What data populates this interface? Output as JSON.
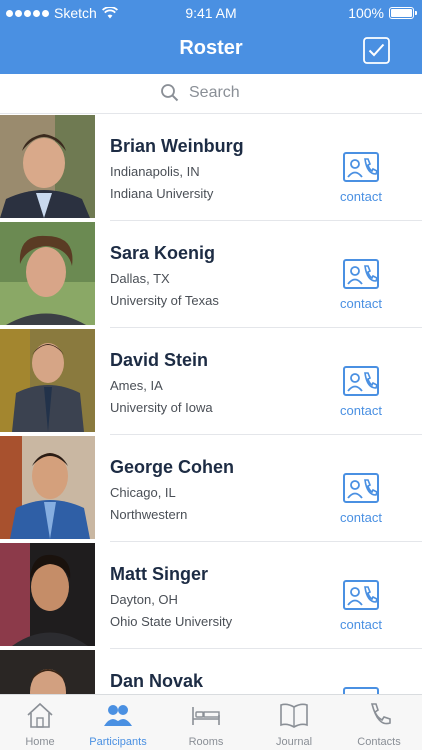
{
  "status_bar": {
    "carrier": "Sketch",
    "time": "9:41 AM",
    "battery": "100%"
  },
  "nav": {
    "title": "Roster",
    "action_icon": "checkbox-icon"
  },
  "search": {
    "placeholder": "Search",
    "icon": "search-icon"
  },
  "participants": [
    {
      "name": "Brian Weinburg",
      "location": "Indianapolis, IN",
      "school": "Indiana University",
      "contact_label": "contact"
    },
    {
      "name": "Sara Koenig",
      "location": "Dallas, TX",
      "school": "University of Texas",
      "contact_label": "contact"
    },
    {
      "name": "David Stein",
      "location": "Ames, IA",
      "school": "University of Iowa",
      "contact_label": "contact"
    },
    {
      "name": "George Cohen",
      "location": "Chicago, IL",
      "school": "Northwestern",
      "contact_label": "contact"
    },
    {
      "name": "Matt Singer",
      "location": "Dayton, OH",
      "school": "Ohio State University",
      "contact_label": "contact"
    },
    {
      "name": "Dan Novak",
      "location": "",
      "school": "",
      "contact_label": ""
    }
  ],
  "tabs": [
    {
      "label": "Home",
      "icon": "home-icon",
      "active": false
    },
    {
      "label": "Participants",
      "icon": "people-icon",
      "active": true
    },
    {
      "label": "Rooms",
      "icon": "bed-icon",
      "active": false
    },
    {
      "label": "Journal",
      "icon": "book-icon",
      "active": false
    },
    {
      "label": "Contacts",
      "icon": "phone-icon",
      "active": false
    }
  ],
  "colors": {
    "accent": "#4a90e2",
    "name_text": "#1d2c44",
    "muted": "#8a8f96"
  }
}
